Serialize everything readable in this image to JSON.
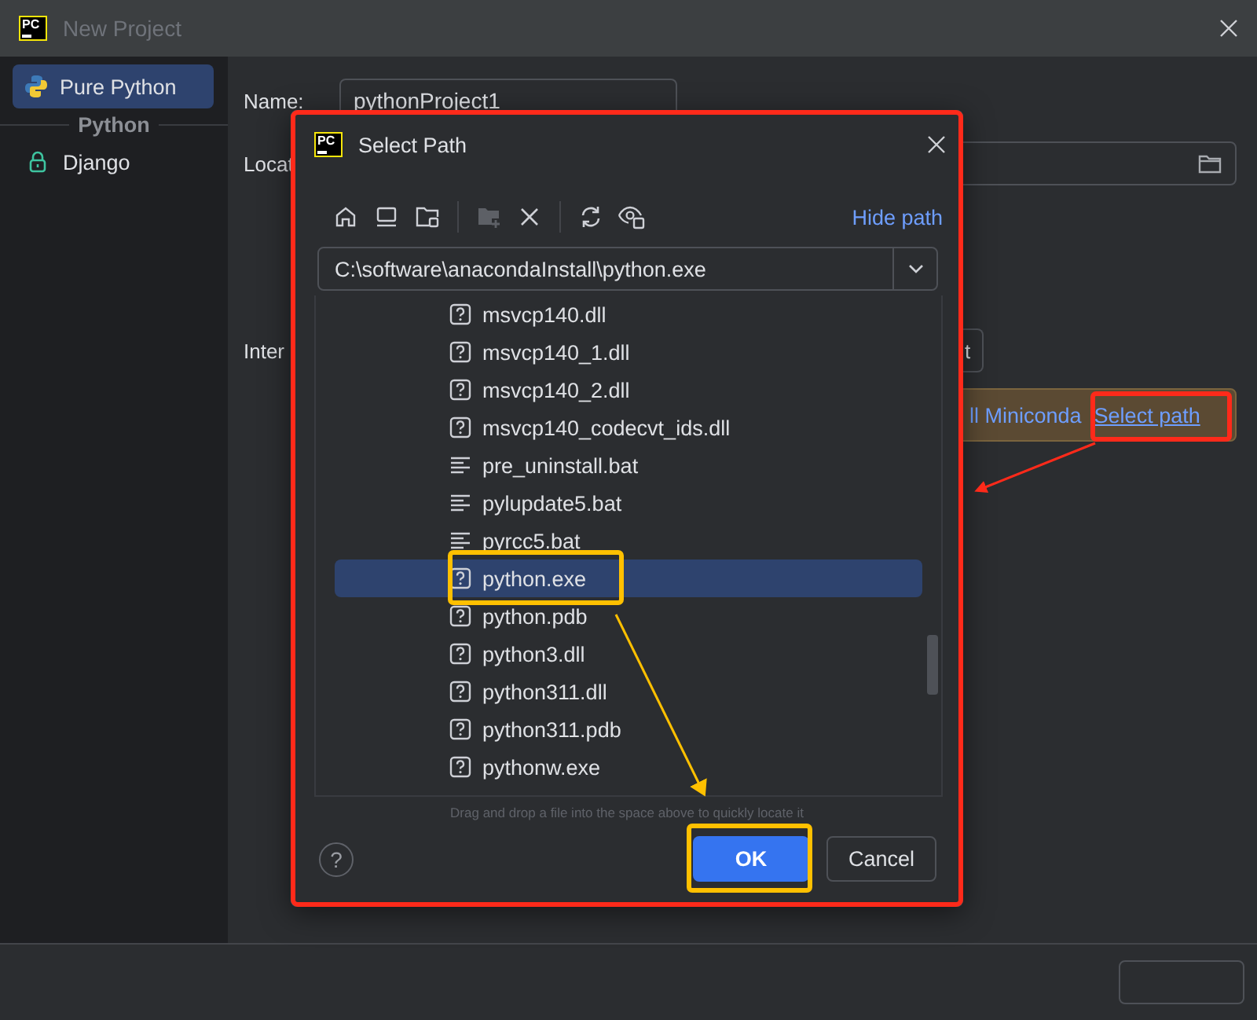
{
  "window": {
    "logo": "PC",
    "title": "New Project"
  },
  "sidebar": {
    "items": [
      {
        "label": "Pure Python",
        "selected": true
      }
    ],
    "group": {
      "title": "Python",
      "items": [
        {
          "label": "Django",
          "selected": false
        }
      ]
    }
  },
  "form": {
    "name_label": "Name:",
    "name_value": "pythonProject1",
    "location_label": "Locat",
    "interpreter_label": "Inter",
    "interpreter_button": "t",
    "banner": {
      "text": "ll Miniconda",
      "link": "Select path"
    }
  },
  "dialog": {
    "logo": "PC",
    "title": "Select Path",
    "hide_path": "Hide path",
    "path": "C:\\software\\anacondaInstall\\python.exe",
    "files": [
      {
        "name": "msvcp140.dll",
        "kind": "unknown",
        "selected": false
      },
      {
        "name": "msvcp140_1.dll",
        "kind": "unknown",
        "selected": false
      },
      {
        "name": "msvcp140_2.dll",
        "kind": "unknown",
        "selected": false
      },
      {
        "name": "msvcp140_codecvt_ids.dll",
        "kind": "unknown",
        "selected": false
      },
      {
        "name": "pre_uninstall.bat",
        "kind": "text",
        "selected": false
      },
      {
        "name": "pylupdate5.bat",
        "kind": "text",
        "selected": false
      },
      {
        "name": "pyrcc5.bat",
        "kind": "text",
        "selected": false
      },
      {
        "name": "python.exe",
        "kind": "unknown",
        "selected": true
      },
      {
        "name": "python.pdb",
        "kind": "unknown",
        "selected": false
      },
      {
        "name": "python3.dll",
        "kind": "unknown",
        "selected": false
      },
      {
        "name": "python311.dll",
        "kind": "unknown",
        "selected": false
      },
      {
        "name": "python311.pdb",
        "kind": "unknown",
        "selected": false
      },
      {
        "name": "pythonw.exe",
        "kind": "unknown",
        "selected": false
      }
    ],
    "hint": "Drag and drop a file into the space above to quickly locate it",
    "help": "?",
    "ok": "OK",
    "cancel": "Cancel"
  }
}
